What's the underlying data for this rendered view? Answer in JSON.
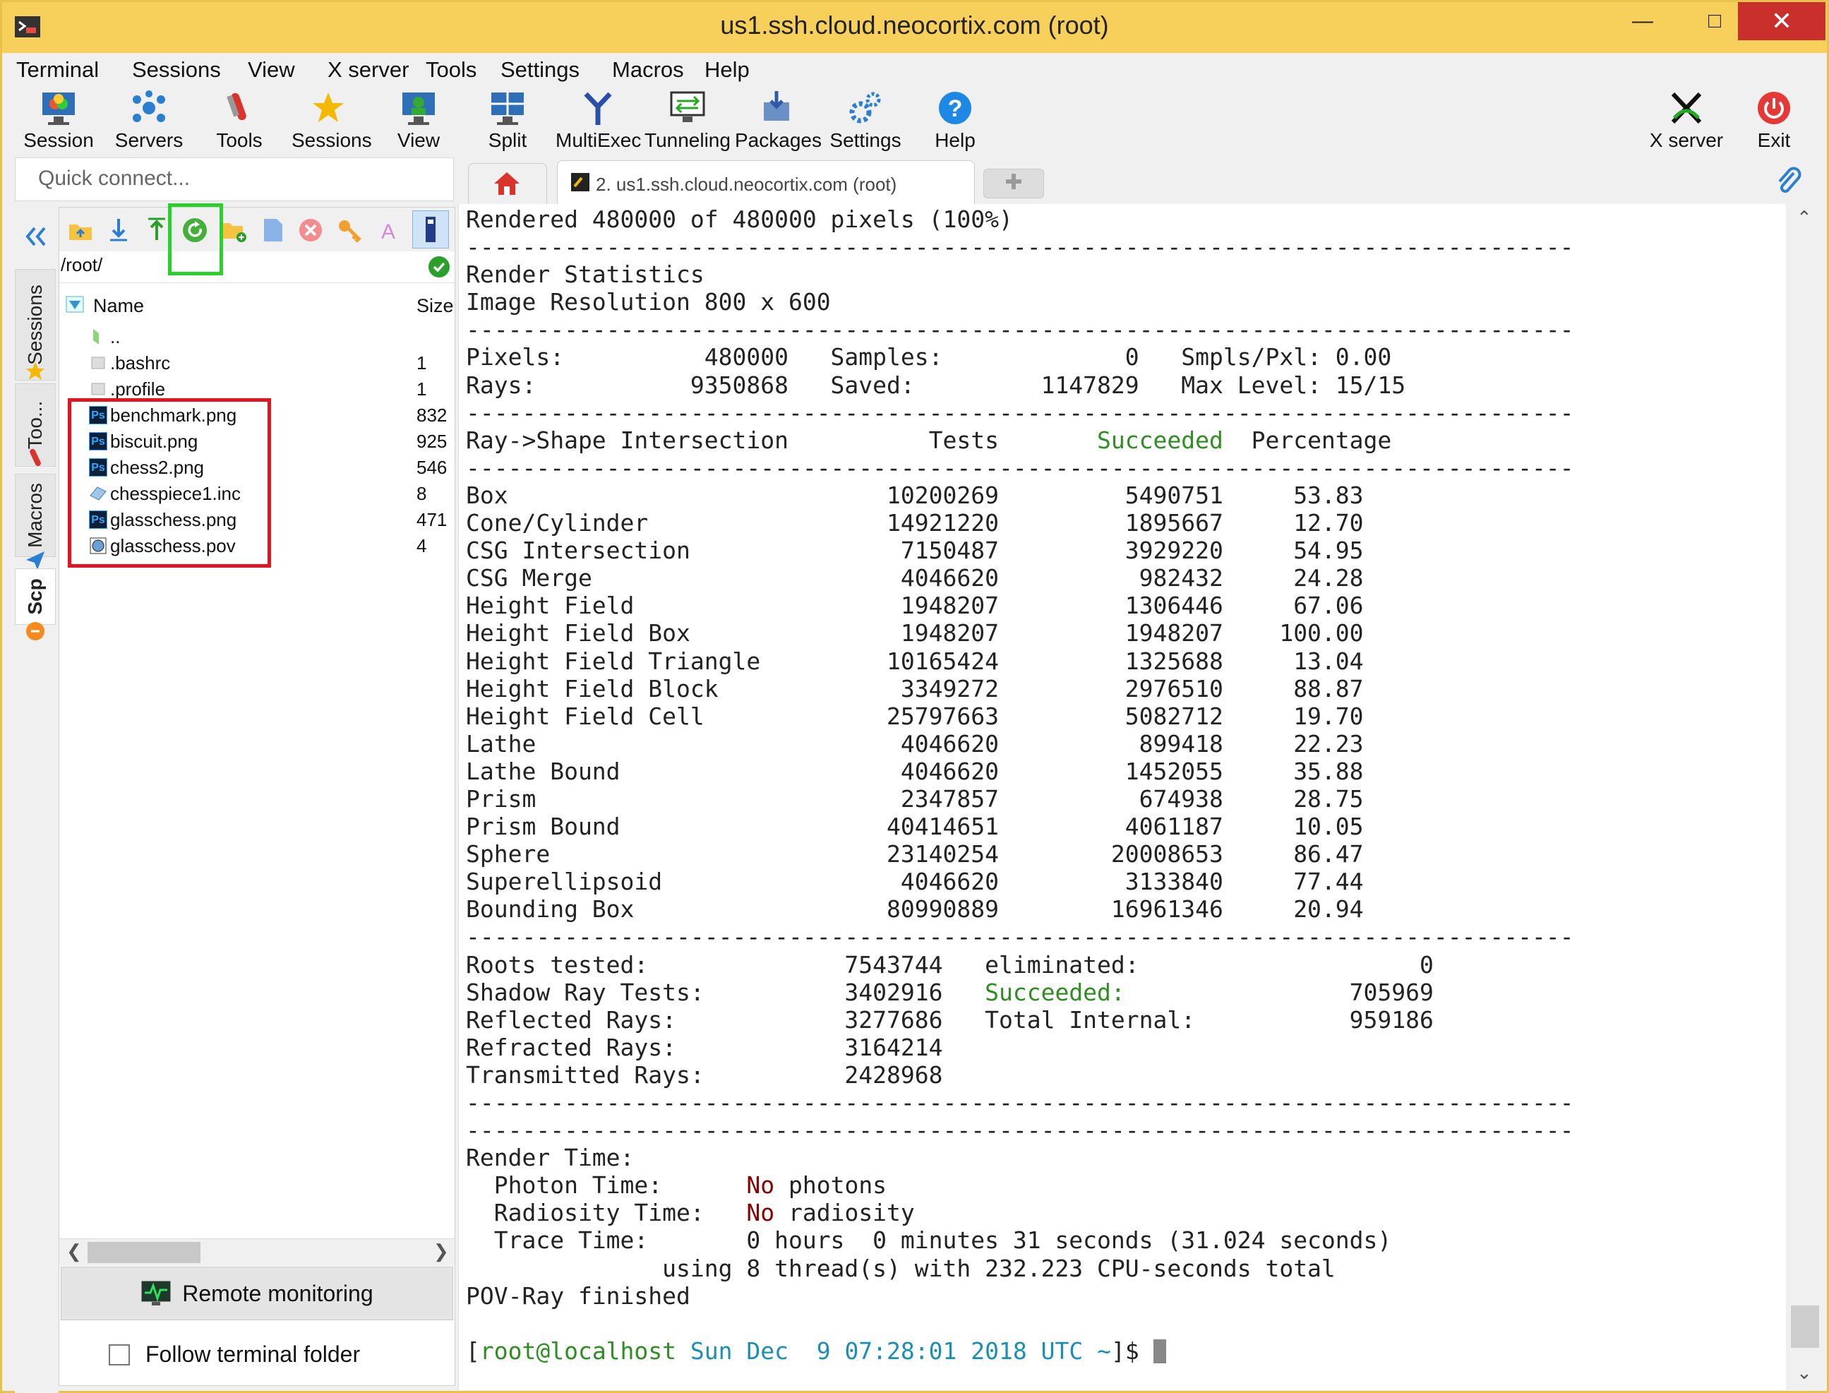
{
  "window": {
    "title": "us1.ssh.cloud.neocortix.com (root)"
  },
  "menu": [
    "Terminal",
    "Sessions",
    "View",
    "X server",
    "Tools",
    "Settings",
    "Macros",
    "Help"
  ],
  "toolbar": {
    "session": "Session",
    "servers": "Servers",
    "tools": "Tools",
    "sessions": "Sessions",
    "view": "View",
    "split": "Split",
    "multiexec": "MultiExec",
    "tunneling": "Tunneling",
    "packages": "Packages",
    "settings": "Settings",
    "help": "Help",
    "xserver": "X server",
    "exit": "Exit"
  },
  "quick_connect": {
    "placeholder": "Quick connect..."
  },
  "tabs": {
    "active": "2. us1.ssh.cloud.neocortix.com (root)"
  },
  "sidetabs": {
    "sessions": "Sessions",
    "tools": "Too...",
    "macros": "Macros",
    "scp": "Scp"
  },
  "scp": {
    "path": "/root/",
    "col_name": "Name",
    "col_size": "Size",
    "files": [
      {
        "name": "..",
        "size": ""
      },
      {
        "name": ".bashrc",
        "size": "1"
      },
      {
        "name": ".profile",
        "size": "1"
      },
      {
        "name": "benchmark.png",
        "size": "832"
      },
      {
        "name": "biscuit.png",
        "size": "925"
      },
      {
        "name": "chess2.png",
        "size": "546"
      },
      {
        "name": "chesspiece1.inc",
        "size": "8"
      },
      {
        "name": "glasschess.png",
        "size": "471"
      },
      {
        "name": "glasschess.pov",
        "size": "4"
      }
    ],
    "remote_monitoring": "Remote monitoring",
    "follow_terminal": "Follow terminal folder"
  },
  "terminal": {
    "rendered": "Rendered 480000 of 480000 pixels (100%)",
    "dashes": "-------------------------------------------------------------------------------",
    "render_statistics": "Render Statistics",
    "image_resolution": "Image Resolution 800 x 600",
    "pixels_line": "Pixels:          480000   Samples:             0   Smpls/Pxl: 0.00",
    "rays_line": "Rays:           9350868   Saved:         1147829   Max Level: 15/15",
    "header_a": "Ray->Shape Intersection          Tests       ",
    "header_succeeded": "Succeeded",
    "header_b": "  Percentage",
    "rows": [
      "Box                           10200269         5490751     53.83",
      "Cone/Cylinder                 14921220         1895667     12.70",
      "CSG Intersection               7150487         3929220     54.95",
      "CSG Merge                      4046620          982432     24.28",
      "Height Field                   1948207         1306446     67.06",
      "Height Field Box               1948207         1948207    100.00",
      "Height Field Triangle         10165424         1325688     13.04",
      "Height Field Block             3349272         2976510     88.87",
      "Height Field Cell             25797663         5082712     19.70",
      "Lathe                          4046620          899418     22.23",
      "Lathe Bound                    4046620         1452055     35.88",
      "Prism                          2347857          674938     28.75",
      "Prism Bound                   40414651         4061187     10.05",
      "Sphere                        23140254        20008653     86.47",
      "Superellipsoid                 4046620         3133840     77.44",
      "Bounding Box                  80990889        16961346     20.94"
    ],
    "roots_line": "Roots tested:              7543744   eliminated:                    0",
    "shadow_a": "Shadow Ray Tests:          3402916   ",
    "shadow_succeeded": "Succeeded:",
    "shadow_b": "                705969",
    "reflected_line": "Reflected Rays:            3277686   Total Internal:           959186",
    "refracted_line": "Refracted Rays:            3164214",
    "transmitted_line": "Transmitted Rays:          2428968",
    "render_time": "Render Time:",
    "photon_a": "  Photon Time:      ",
    "photon_no": "No",
    "photon_b": " photons",
    "radiosity_a": "  Radiosity Time:   ",
    "radiosity_no": "No",
    "radiosity_b": " radiosity",
    "trace_line": "  Trace Time:       0 hours  0 minutes 31 seconds (31.024 seconds)",
    "using_line": "              using 8 thread(s) with 232.223 CPU-seconds total",
    "finished": "POV-Ray finished",
    "prompt_open": "[",
    "prompt_user": "root@localhost",
    "prompt_date": " Sun Dec  9 07:28:01 2018 UTC",
    "prompt_dir": " ~",
    "prompt_close": "]$ "
  },
  "colors": {
    "titlebar": "#f6d05a",
    "close": "#c9302c",
    "succeeded": "#2c8f20",
    "no": "#8b0000",
    "prompt": "#1a8fb5",
    "redbox": "#e3141d",
    "greenbox": "#2ad12a"
  }
}
